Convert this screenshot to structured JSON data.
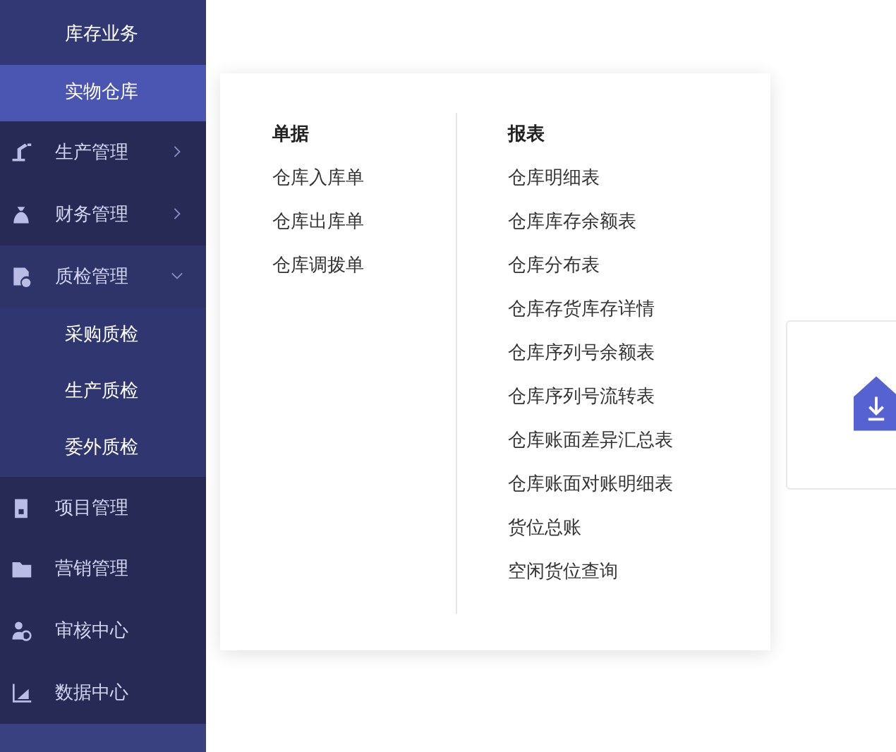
{
  "sidebar": {
    "items": [
      {
        "kind": "sub",
        "label": "库存业务",
        "selected": false
      },
      {
        "kind": "sub",
        "label": "实物仓库",
        "selected": true
      },
      {
        "kind": "group",
        "label": "生产管理",
        "expanded": false,
        "selected": false
      },
      {
        "kind": "group",
        "label": "财务管理",
        "expanded": false,
        "selected": false
      },
      {
        "kind": "group",
        "label": "质检管理",
        "expanded": true,
        "selected": false,
        "children": [
          {
            "kind": "sub",
            "label": "采购质检",
            "selected": false
          },
          {
            "kind": "sub",
            "label": "生产质检",
            "selected": false
          },
          {
            "kind": "sub",
            "label": "委外质检",
            "selected": false
          }
        ]
      },
      {
        "kind": "group",
        "label": "项目管理",
        "selected": false
      },
      {
        "kind": "group",
        "label": "营销管理",
        "selected": false
      },
      {
        "kind": "group",
        "label": "审核中心",
        "selected": false
      },
      {
        "kind": "group",
        "label": "数据中心",
        "selected": false
      }
    ]
  },
  "flyout": {
    "columns": [
      {
        "title": "单据",
        "links": [
          "仓库入库单",
          "仓库出库单",
          "仓库调拨单"
        ]
      },
      {
        "title": "报表",
        "links": [
          "仓库明细表",
          "仓库库存余额表",
          "仓库分布表",
          "仓库存货库存详情",
          "仓库序列号余额表",
          "仓库序列号流转表",
          "仓库账面差异汇总表",
          "仓库账面对账明细表",
          "货位总账",
          "空闲货位查询"
        ]
      }
    ]
  }
}
